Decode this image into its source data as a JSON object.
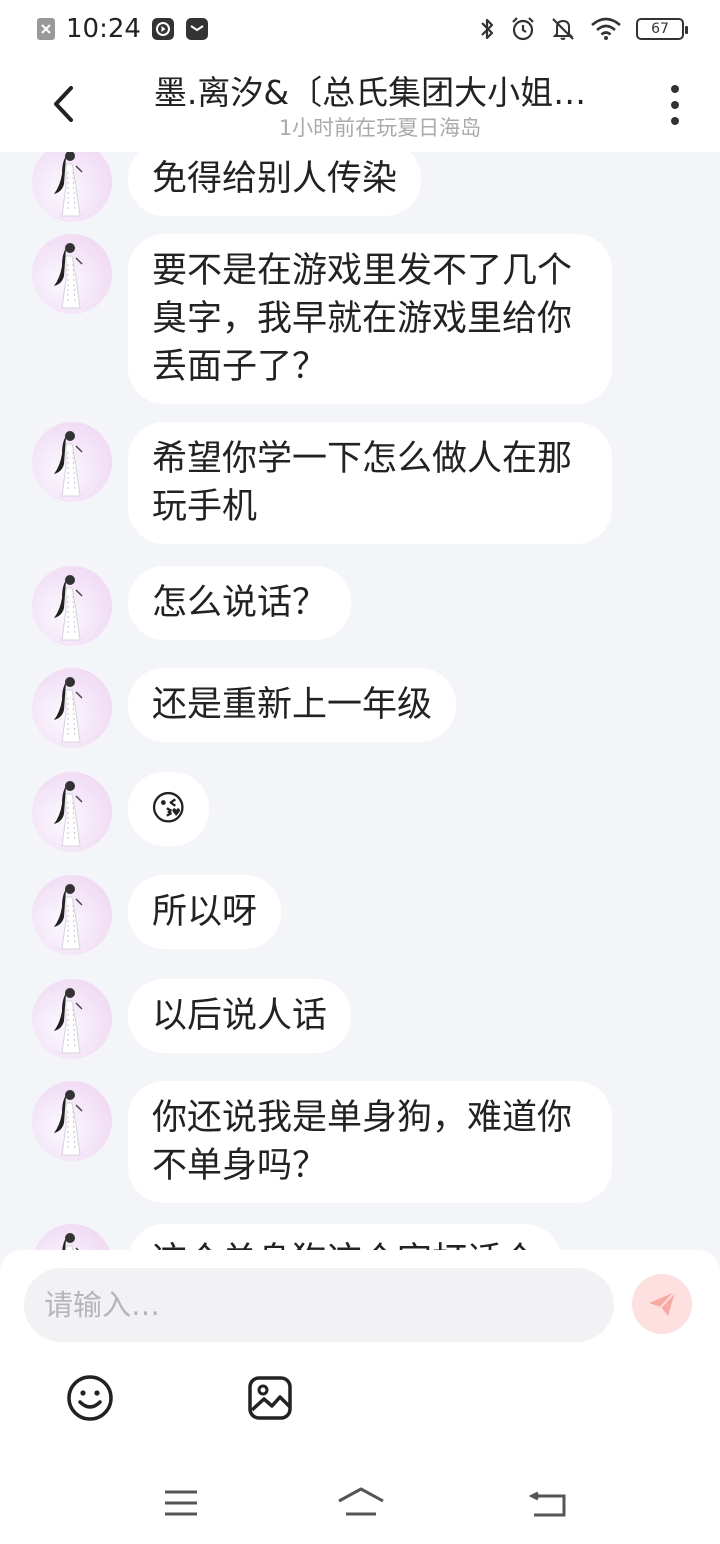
{
  "status_bar": {
    "time": "10:24",
    "battery": "67",
    "left_icons": [
      "close-box-icon",
      "play-box-icon",
      "mail-icon"
    ],
    "right_icons": [
      "bluetooth-icon",
      "alarm-icon",
      "mute-icon",
      "wifi-icon",
      "battery-icon"
    ]
  },
  "header": {
    "title": "墨.离汐&〔总氏集团大小姐…",
    "subtitle": "1小时前在玩夏日海岛"
  },
  "messages": [
    {
      "text": "免得给别人传染"
    },
    {
      "text": "要不是在游戏里发不了几个臭字，我早就在游戏里给你丢面子了？"
    },
    {
      "text": "希望你学一下怎么做人在那玩手机"
    },
    {
      "text": "怎么说话？"
    },
    {
      "text": "还是重新上一年级"
    },
    {
      "text": "😘"
    },
    {
      "text": "所以呀"
    },
    {
      "text": "以后说人话"
    },
    {
      "text": "你还说我是单身狗，难道你不单身吗？"
    },
    {
      "text": "这个单身狗这个字打话个"
    }
  ],
  "input": {
    "placeholder": "请输入…"
  },
  "colors": {
    "background": "#f4f5f8",
    "bubble": "#ffffff",
    "send_button": "#fde0df",
    "send_icon": "#f7a9a3"
  }
}
